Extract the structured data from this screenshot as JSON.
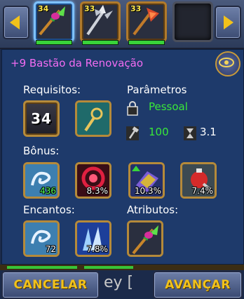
{
  "selector": {
    "slots": [
      {
        "level": "34",
        "icon": "green-gem-staff-icon",
        "selected": true,
        "progress": 1.0
      },
      {
        "level": "33",
        "icon": "silver-trident-icon",
        "selected": false,
        "progress": 1.0
      },
      {
        "level": "33",
        "icon": "red-crystal-scythe-icon",
        "selected": false,
        "progress": 1.0
      },
      {
        "level": "",
        "icon": "empty-slot",
        "selected": false,
        "progress": null
      }
    ]
  },
  "item": {
    "title": "+9 Bastão da Renovação"
  },
  "requirements": {
    "label": "Requisitos:",
    "level": "34",
    "class_icon": "healer-class-icon"
  },
  "parameters": {
    "label": "Parâmetros",
    "binding": "Pessoal",
    "durability": "100",
    "weight": "3.1"
  },
  "bonus": {
    "label": "Bônus:",
    "items": [
      {
        "icon": "healing-swirl-icon",
        "value": "436",
        "green": true
      },
      {
        "icon": "red-vortex-icon",
        "value": "8.3%",
        "green": false
      },
      {
        "icon": "purple-book-icon",
        "value": "10.3%",
        "green": false
      },
      {
        "icon": "red-potion-icon",
        "value": "7.4%",
        "green": false
      }
    ]
  },
  "enchants": {
    "label": "Encantos:",
    "items": [
      {
        "icon": "healing-swirl-icon",
        "value": "72"
      },
      {
        "icon": "ice-crystals-icon",
        "value": "7.8%"
      }
    ]
  },
  "attributes": {
    "label": "Atributos:",
    "items": [
      {
        "icon": "green-gem-staff-icon"
      }
    ]
  },
  "footer": {
    "cancel_label": "CANCELAR",
    "next_label": "AVANÇAR",
    "partial_text": "ey [",
    "colors": {
      "accent": "#f2c21a",
      "title": "#f26cf2",
      "green": "#39e839"
    }
  }
}
